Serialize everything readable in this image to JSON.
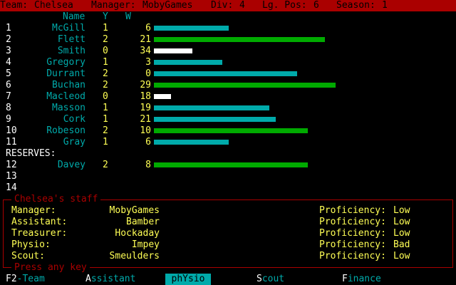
{
  "header": {
    "team_label": "Team:",
    "team": "Chelsea",
    "manager_label": "Manager:",
    "manager": "MobyGames",
    "div_label": "Div:",
    "div": "4",
    "lg_pos_label": "Lg. Pos:",
    "lg_pos": "6",
    "season_label": "Season:",
    "season": "1"
  },
  "columns": {
    "name": "Name",
    "y": "Y",
    "w": "W"
  },
  "players": [
    {
      "num": "1",
      "name": "McGill",
      "y": "1",
      "w": "6",
      "bar": 0.35,
      "color": "#00aaaa"
    },
    {
      "num": "2",
      "name": "Flett",
      "y": "2",
      "w": "21",
      "bar": 0.8,
      "color": "#00aa00"
    },
    {
      "num": "3",
      "name": "Smith",
      "y": "0",
      "w": "34",
      "bar": 0.18,
      "color": "#ffffff"
    },
    {
      "num": "4",
      "name": "Gregory",
      "y": "1",
      "w": "3",
      "bar": 0.32,
      "color": "#00aaaa"
    },
    {
      "num": "5",
      "name": "Durrant",
      "y": "2",
      "w": "0",
      "bar": 0.67,
      "color": "#00aaaa"
    },
    {
      "num": "6",
      "name": "Buchan",
      "y": "2",
      "w": "29",
      "bar": 0.85,
      "color": "#00aa00"
    },
    {
      "num": "7",
      "name": "Macleod",
      "y": "0",
      "w": "18",
      "bar": 0.08,
      "color": "#ffffff"
    },
    {
      "num": "8",
      "name": "Masson",
      "y": "1",
      "w": "19",
      "bar": 0.54,
      "color": "#00aaaa"
    },
    {
      "num": "9",
      "name": "Cork",
      "y": "1",
      "w": "21",
      "bar": 0.57,
      "color": "#00aaaa"
    },
    {
      "num": "10",
      "name": "Robeson",
      "y": "2",
      "w": "10",
      "bar": 0.72,
      "color": "#00aa00"
    },
    {
      "num": "11",
      "name": "Gray",
      "y": "1",
      "w": "6",
      "bar": 0.35,
      "color": "#00aaaa"
    }
  ],
  "reserves_label": "RESERVES:",
  "reserves": [
    {
      "num": "12",
      "name": "Davey",
      "y": "2",
      "w": "8",
      "bar": 0.72,
      "color": "#00aa00"
    },
    {
      "num": "13",
      "name": "",
      "y": "",
      "w": "",
      "bar": 0,
      "color": "#000000"
    },
    {
      "num": "14",
      "name": "",
      "y": "",
      "w": "",
      "bar": 0,
      "color": "#000000"
    }
  ],
  "staff": {
    "title": "Chelsea's staff",
    "rows": [
      {
        "role": "Manager:",
        "name": "MobyGames",
        "prof_label": "Proficiency:",
        "prof": "Low"
      },
      {
        "role": "Assistant:",
        "name": "Bamber",
        "prof_label": "Proficiency:",
        "prof": "Low"
      },
      {
        "role": "Treasurer:",
        "name": "Hockaday",
        "prof_label": "Proficiency:",
        "prof": "Low"
      },
      {
        "role": "Physio:",
        "name": "Impey",
        "prof_label": "Proficiency:",
        "prof": "Bad"
      },
      {
        "role": "Scout:",
        "name": "Smeulders",
        "prof_label": "Proficiency:",
        "prof": "Low"
      }
    ]
  },
  "prompt": "Press any key",
  "menu": [
    {
      "hot": "F2",
      "rest": "-Team"
    },
    {
      "hot": "A",
      "rest": "ssistant"
    },
    {
      "hot": "",
      "rest": "phYsio"
    },
    {
      "hot": "S",
      "rest": "cout"
    },
    {
      "hot": "F",
      "rest": "inance"
    }
  ]
}
